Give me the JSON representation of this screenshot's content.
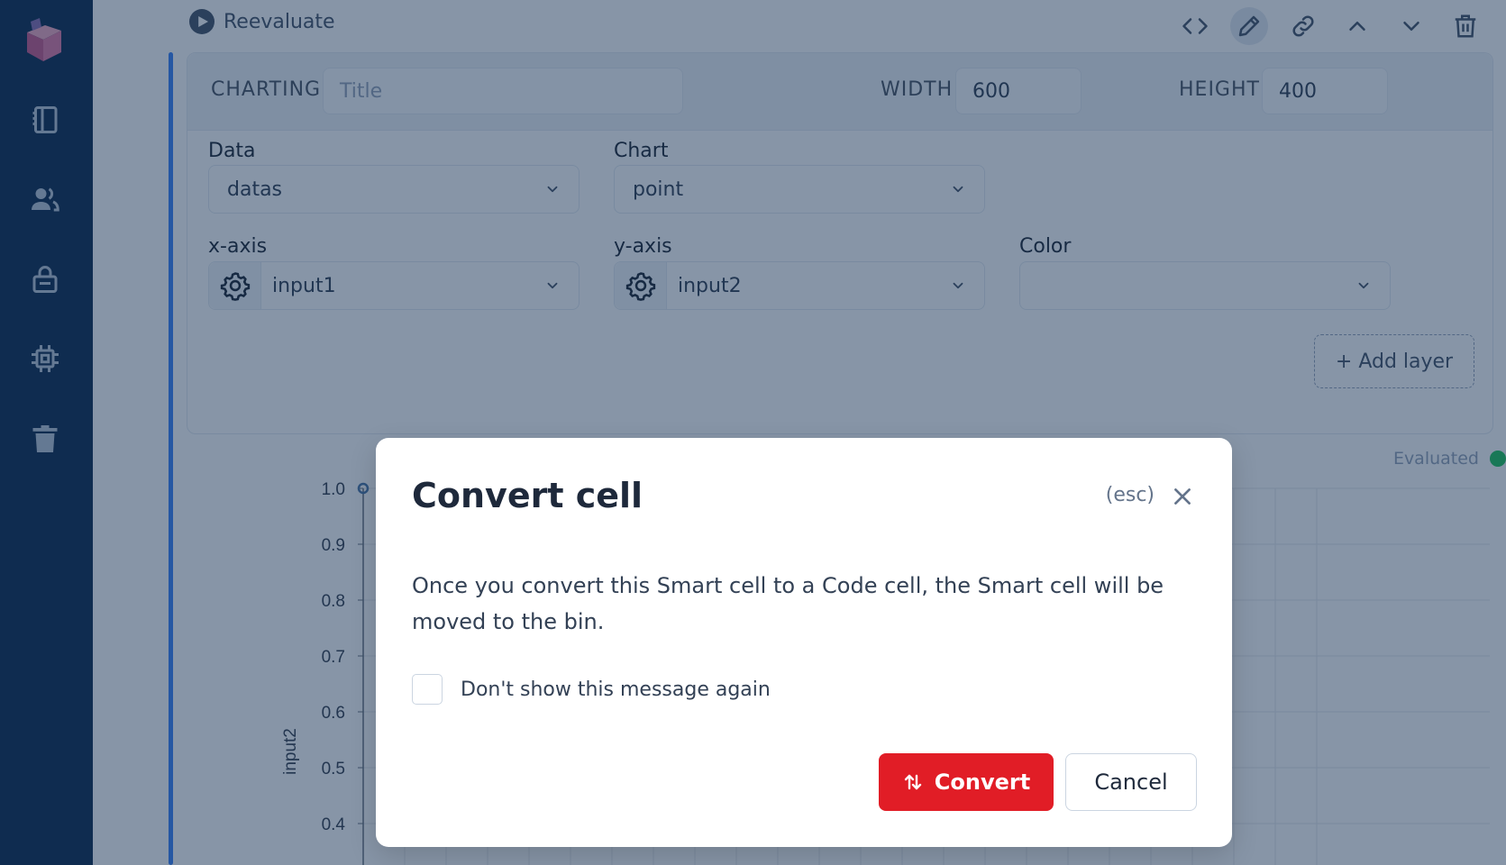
{
  "sidebar": {
    "logo": "livebook-logo-icon",
    "items": [
      {
        "icon": "notebook-icon"
      },
      {
        "icon": "users-icon"
      },
      {
        "icon": "lock-icon"
      },
      {
        "icon": "cpu-icon"
      },
      {
        "icon": "trash-icon"
      }
    ]
  },
  "toolbar": {
    "reevaluate_label": "Reevaluate",
    "icons": [
      "code-icon",
      "pencil-icon",
      "link-icon",
      "chevron-up-icon",
      "chevron-down-icon",
      "trash-icon"
    ]
  },
  "charting": {
    "label": "CHARTING",
    "title_placeholder": "Title",
    "width_label": "WIDTH",
    "width_value": "600",
    "height_label": "HEIGHT",
    "height_value": "400"
  },
  "fields": {
    "data_label": "Data",
    "data_value": "datas",
    "chart_label": "Chart",
    "chart_value": "point",
    "x_label": "x-axis",
    "x_value": "input1",
    "y_label": "y-axis",
    "y_value": "input2",
    "color_label": "Color",
    "color_value": "",
    "add_layer": "+ Add layer"
  },
  "status": {
    "evaluated": "Evaluated",
    "color": "#22c55e"
  },
  "chart_data": {
    "type": "scatter",
    "ylabel": "input2",
    "y_ticks": [
      "1.0",
      "0.9",
      "0.8",
      "0.7",
      "0.6",
      "0.5",
      "0.4"
    ],
    "points": [
      {
        "x": 0,
        "y": 1.0
      }
    ]
  },
  "modal": {
    "title": "Convert cell",
    "esc_hint": "(esc)",
    "body": "Once you convert this Smart cell to a Code cell, the Smart cell will be moved to the bin.",
    "checkbox_label": "Don't show this message again",
    "convert_label": "Convert",
    "cancel_label": "Cancel",
    "accent": "#e11d26"
  }
}
